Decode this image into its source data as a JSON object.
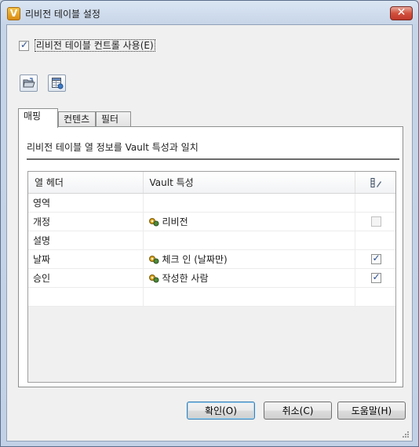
{
  "window": {
    "title": "리비전 테이블 설정",
    "app_icon_letter": "V",
    "close_glyph": "✕"
  },
  "use_control": {
    "label": "리비전 테이블 컨트롤 사용(E)",
    "checked": true
  },
  "toolbar": {
    "open_icon": "folder-open-icon",
    "table_icon": "table-settings-icon"
  },
  "tabs": [
    {
      "label": "매핑",
      "active": true
    },
    {
      "label": "컨텐츠",
      "active": false
    },
    {
      "label": "필터",
      "active": false
    }
  ],
  "mapping": {
    "description": "리비전 테이블 열 정보를 Vault 특성과 일치",
    "columns": [
      "열 헤더",
      "Vault 특성",
      "column-settings-icon"
    ],
    "rows": [
      {
        "header": "영역",
        "property": "",
        "has_checkbox": false,
        "checked": false
      },
      {
        "header": "개정",
        "property": "리비전",
        "has_checkbox": true,
        "checked": false,
        "disabled": true
      },
      {
        "header": "설명",
        "property": "",
        "has_checkbox": false,
        "checked": false
      },
      {
        "header": "날짜",
        "property": "체크 인 (날짜만)",
        "has_checkbox": true,
        "checked": true
      },
      {
        "header": "승인",
        "property": "작성한 사람",
        "has_checkbox": true,
        "checked": true
      }
    ]
  },
  "buttons": {
    "ok": "확인(O)",
    "cancel": "취소(C)",
    "help": "도움말(H)"
  },
  "colors": {
    "accent_border": "#3c7fb1",
    "close_red": "#c0392b"
  }
}
